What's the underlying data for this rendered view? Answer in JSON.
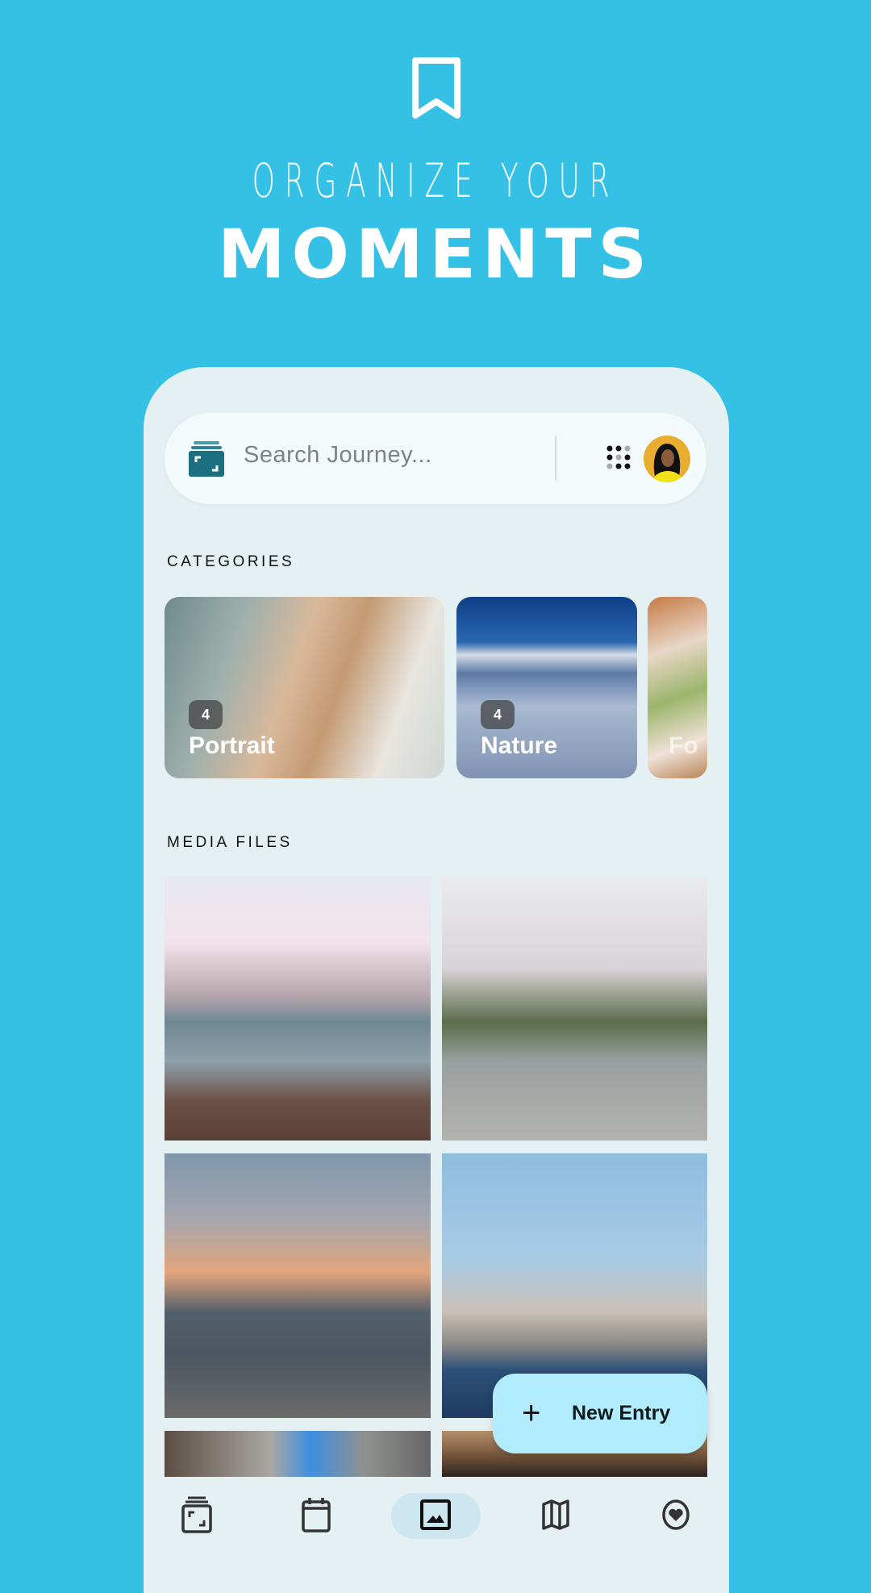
{
  "hero": {
    "icon": "bookmark-icon",
    "tagline_line1": "ORGANIZE YOUR",
    "tagline_line2": "MOMENTS"
  },
  "search": {
    "logo_icon": "journey-logo-icon",
    "placeholder": "Search Journey...",
    "grid_icon": "dots-grid-icon",
    "avatar": "user-avatar"
  },
  "categories": {
    "title": "CATEGORIES",
    "items": [
      {
        "count": "4",
        "name": "Portrait"
      },
      {
        "count": "4",
        "name": "Nature"
      },
      {
        "count": "",
        "name": "Fo"
      }
    ]
  },
  "media": {
    "title": "MEDIA FILES"
  },
  "fab": {
    "icon": "plus-icon",
    "label": "New Entry"
  },
  "nav": {
    "items": [
      {
        "icon": "journal-icon"
      },
      {
        "icon": "calendar-icon"
      },
      {
        "icon": "photo-icon",
        "active": true
      },
      {
        "icon": "map-icon"
      },
      {
        "icon": "heart-circle-icon"
      }
    ]
  },
  "colors": {
    "background": "#35c1e5",
    "phone": "#e5f0f3",
    "fab": "#b0ecfb",
    "accent": "#1a6f80"
  }
}
